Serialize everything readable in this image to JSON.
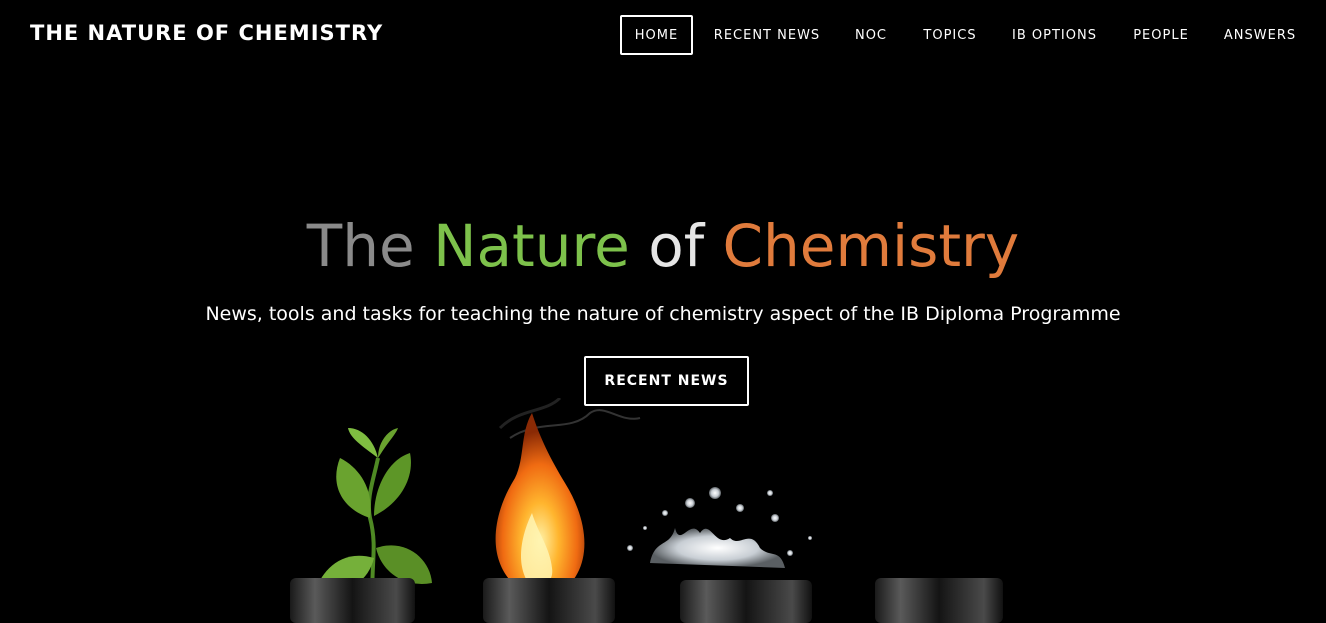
{
  "header": {
    "site_title": "THE NATURE OF CHEMISTRY",
    "nav": [
      {
        "label": "HOME",
        "active": true
      },
      {
        "label": "RECENT NEWS",
        "active": false
      },
      {
        "label": "NOC",
        "active": false
      },
      {
        "label": "TOPICS",
        "active": false
      },
      {
        "label": "IB OPTIONS",
        "active": false
      },
      {
        "label": "PEOPLE",
        "active": false
      },
      {
        "label": "ANSWERS",
        "active": false
      }
    ]
  },
  "hero": {
    "title_parts": [
      {
        "text": "The",
        "color": "#8a8a8a"
      },
      {
        "text": "Nature",
        "color": "#7dc14b"
      },
      {
        "text": "of",
        "color": "#e6e6e6"
      },
      {
        "text": "Chemistry",
        "color": "#e07b3c"
      }
    ],
    "subtitle": "News, tools and tasks for teaching the nature of chemistry aspect of the IB Diploma Programme",
    "button_label": "RECENT NEWS"
  },
  "colors": {
    "background": "#000000",
    "text": "#ffffff",
    "leaf": "#6aa32f",
    "flame": "#f28a1e",
    "water": "#cfd6dc",
    "glass": "#3a3a3a"
  }
}
